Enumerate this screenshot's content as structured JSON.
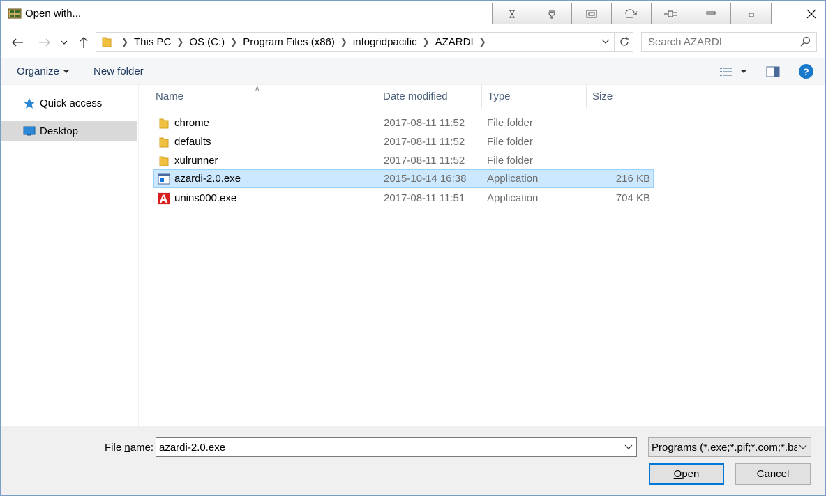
{
  "window": {
    "title": "Open with...",
    "toolstrip_icons": [
      "hourglass-icon",
      "wrench-icon",
      "frame-icon",
      "undo-arrow-icon",
      "plug-icon",
      "minimize-bar-icon",
      "restore-square-icon"
    ]
  },
  "address": {
    "crumbs": [
      "This PC",
      "OS (C:)",
      "Program Files (x86)",
      "infogridpacific",
      "AZARDI"
    ],
    "search_placeholder": "Search AZARDI"
  },
  "toolbar": {
    "organize_label": "Organize",
    "new_folder_label": "New folder"
  },
  "navpane": {
    "items": [
      {
        "label": "Quick access",
        "icon": "star-icon",
        "selected": false
      },
      {
        "label": "Desktop",
        "icon": "desktop-icon",
        "selected": true
      }
    ]
  },
  "filelist": {
    "columns": [
      "Name",
      "Date modified",
      "Type",
      "Size"
    ],
    "rows": [
      {
        "name": "chrome",
        "date": "2017-08-11 11:52",
        "type": "File folder",
        "size": "",
        "icon": "folder-icon"
      },
      {
        "name": "defaults",
        "date": "2017-08-11 11:52",
        "type": "File folder",
        "size": "",
        "icon": "folder-icon"
      },
      {
        "name": "xulrunner",
        "date": "2017-08-11 11:52",
        "type": "File folder",
        "size": "",
        "icon": "folder-icon"
      },
      {
        "name": "azardi-2.0.exe",
        "date": "2015-10-14 16:38",
        "type": "Application",
        "size": "216 KB",
        "icon": "application-icon",
        "selected": true
      },
      {
        "name": "unins000.exe",
        "date": "2017-08-11 11:51",
        "type": "Application",
        "size": "704 KB",
        "icon": "uninstaller-icon"
      }
    ]
  },
  "footer": {
    "filename_label_pre": "File ",
    "filename_label_u": "n",
    "filename_label_post": "ame:",
    "filename_value": "azardi-2.0.exe",
    "filter_value": "Programs (*.exe;*.pif;*.com;*.bat",
    "open_u": "O",
    "open_rest": "pen",
    "cancel_label": "Cancel"
  },
  "colors": {
    "selection_bg": "#cce8ff",
    "selection_border": "#99d1ff",
    "accent": "#0078d7",
    "folder": "#f0c040"
  }
}
